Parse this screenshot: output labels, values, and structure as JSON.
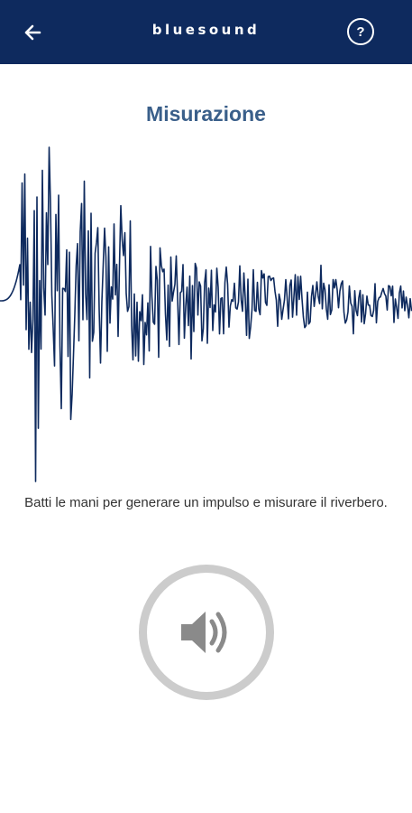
{
  "app_bar": {
    "brand": "bluesound",
    "back_icon": "arrow-left-icon",
    "help_label": "?",
    "background": "#0e2a5e"
  },
  "main": {
    "title": "Misurazione",
    "waveform_color": "#0e2a5e",
    "instruction": "Batti le mani per generare un impulso e misurare il riverbero.",
    "measure_button_icon": "speaker-icon"
  }
}
